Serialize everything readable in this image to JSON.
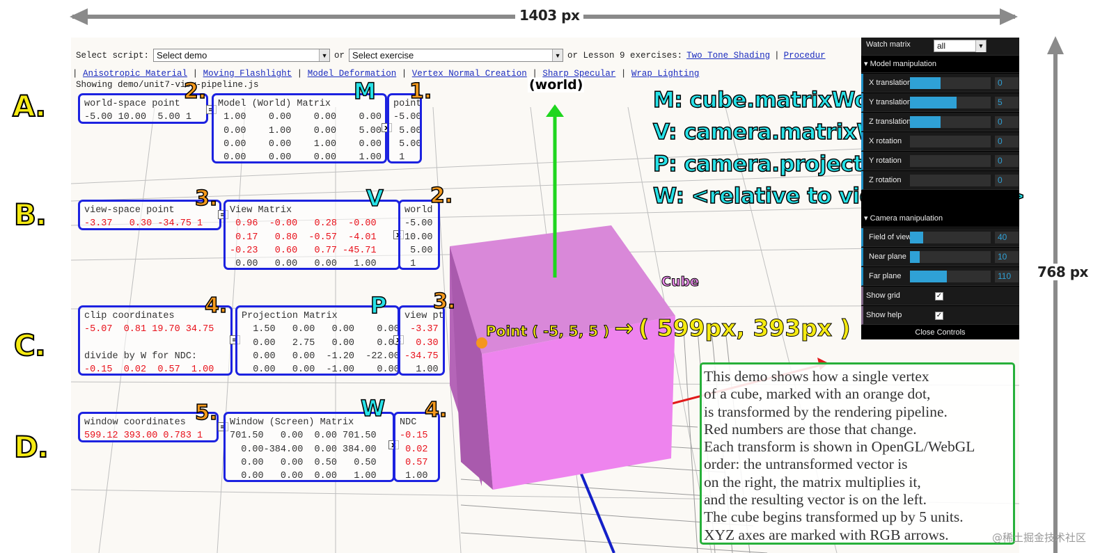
{
  "dimensions": {
    "width_label": "1403 px",
    "height_label": "768 px"
  },
  "toolbar": {
    "select_script_label": "Select script:",
    "demo_select_value": "Select demo",
    "or_label": "or",
    "exercise_select_value": "Select exercise",
    "lesson_label": "or Lesson 9 exercises:",
    "links": [
      "Two Tone Shading",
      "Procedur",
      "Anisotropic Material",
      "Moving Flashlight",
      "Model Deformation",
      "Vertex Normal Creation",
      "Sharp Specular",
      "Wrap Lighting"
    ],
    "status": "Showing demo/unit7-view-pipeline.js"
  },
  "rows": {
    "a": "A.",
    "b": "B.",
    "c": "C.",
    "d": "D."
  },
  "steps": {
    "s1": "1.",
    "s2": "2.",
    "s3": "3.",
    "s4": "4.",
    "s5": "5."
  },
  "matrix_letters": {
    "m": "M",
    "v": "V",
    "p": "P",
    "w": "W"
  },
  "ops": {
    "eq": "=",
    "times": "x"
  },
  "legend": [
    "M: cube.matrixWorld",
    "V: camera.matrixWorldInverse",
    "P: camera.projectionMatrix",
    "W: <relative to viewport dims>"
  ],
  "matrices": {
    "world_point": {
      "header": "world-space point",
      "values": "-5.00 10.00  5.00 1"
    },
    "model_matrix": {
      "header": "Model (World) Matrix",
      "rows": [
        " 1.00    0.00    0.00    0.00",
        " 0.00    1.00    0.00    5.00",
        " 0.00    0.00    1.00    0.00",
        " 0.00    0.00    0.00    1.00"
      ]
    },
    "model_point": {
      "header": "point",
      "rows": [
        "-5.00",
        " 5.00",
        " 5.00",
        " 1"
      ]
    },
    "view_point": {
      "header": "view-space point",
      "values": "-3.37   0.30 -34.75 1"
    },
    "view_matrix": {
      "header": "View Matrix",
      "rows": [
        " 0.96  -0.00   0.28  -0.00",
        " 0.17   0.80  -0.57  -4.01",
        "-0.23   0.60   0.77 -45.71",
        " 0.00   0.00   0.00   1.00"
      ]
    },
    "view_world": {
      "header": "world",
      "rows": [
        "-5.00",
        "10.00",
        " 5.00",
        " 1"
      ]
    },
    "clip_point": {
      "header": "clip coordinates",
      "values": "-5.07  0.81 19.70 34.75",
      "ndc_label": "divide by W for NDC:",
      "ndc_values": "-0.15  0.02  0.57  1.00"
    },
    "proj_matrix": {
      "header": "Projection Matrix",
      "rows": [
        "  1.50   0.00   0.00    0.00",
        "  0.00   2.75   0.00    0.00",
        "  0.00   0.00  -1.20  -22.00",
        "  0.00   0.00  -1.00    0.00"
      ]
    },
    "proj_view": {
      "header": "view pt",
      "rows": [
        " -3.37",
        "  0.30",
        "-34.75",
        "  1.00"
      ]
    },
    "window_point": {
      "header": "window coordinates",
      "values": "599.12 393.00 0.783 1"
    },
    "window_matrix": {
      "header": "Window (Screen) Matrix",
      "rows": [
        "701.50   0.00  0.00 701.50",
        "  0.00-384.00  0.00 384.00",
        "  0.00   0.00  0.50   0.50",
        "  0.00   0.00  0.00   1.00"
      ]
    },
    "window_ndc": {
      "header": "NDC",
      "rows": [
        "-0.15",
        " 0.02",
        " 0.57",
        " 1.00"
      ]
    }
  },
  "scene": {
    "world_label": "(world)",
    "cube_label": "Cube",
    "point_small": "Point ( -5, 5, 5 )",
    "point_arrow": "→",
    "point_big": "( 599px, 393px )"
  },
  "controls": {
    "watch_label": "Watch matrix",
    "watch_value": "all",
    "model_header": "Model manipulation",
    "model_rows": [
      {
        "label": "X translation",
        "value": "0",
        "fraction": 0.38
      },
      {
        "label": "Y translation",
        "value": "5",
        "fraction": 0.58
      },
      {
        "label": "Z translation",
        "value": "0",
        "fraction": 0.38
      },
      {
        "label": "X rotation",
        "value": "0",
        "fraction": 0.0
      },
      {
        "label": "Y rotation",
        "value": "0",
        "fraction": 0.0
      },
      {
        "label": "Z rotation",
        "value": "0",
        "fraction": 0.0
      }
    ],
    "camera_header": "Camera manipulation",
    "camera_rows": [
      {
        "label": "Field of view",
        "value": "40",
        "fraction": 0.16
      },
      {
        "label": "Near plane",
        "value": "10",
        "fraction": 0.12
      },
      {
        "label": "Far plane",
        "value": "110",
        "fraction": 0.46
      }
    ],
    "show_grid": "Show grid",
    "show_help": "Show help",
    "close": "Close Controls"
  },
  "description": [
    "This demo shows how a single vertex",
    "of a cube, marked with an orange dot,",
    "is transformed by the rendering pipeline.",
    "Red numbers are those that change.",
    "Each transform is shown in OpenGL/WebGL",
    "order: the untransformed vector is",
    "on the right, the matrix multiplies it,",
    "and the resulting vector is on the left.",
    "The cube begins transformed up by 5 units.",
    "XYZ axes are marked with RGB arrows."
  ],
  "watermark": "@稀土掘金技术社区",
  "colors": {
    "cube_front": "#ee84ee",
    "cube_side": "#b565b8",
    "cube_top": "#d98ad9",
    "box_border": "#1c22e0",
    "accent_cyan": "#27e2e8"
  }
}
